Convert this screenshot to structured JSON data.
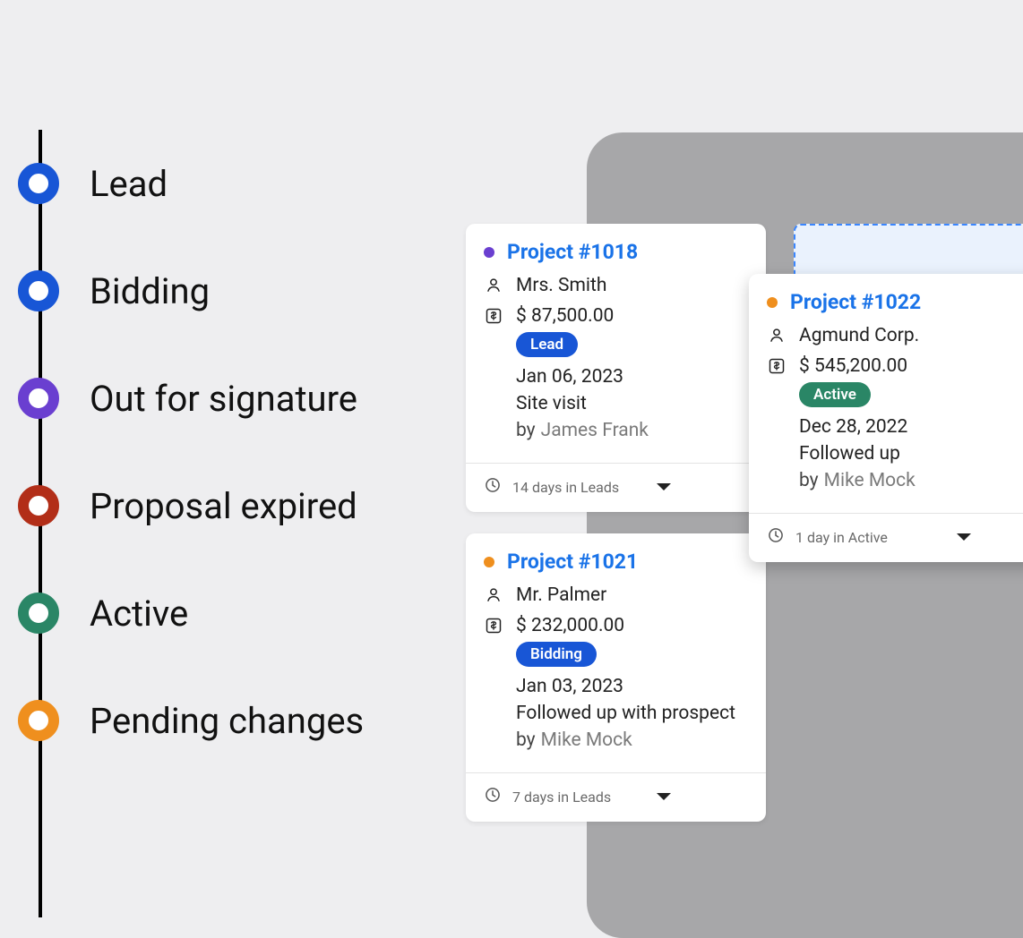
{
  "colors": {
    "blue": "#1856d6",
    "purple": "#6a3fd0",
    "redbrown": "#b22e18",
    "teal": "#2a8666",
    "orange": "#ef8f1e",
    "badge_blue": "#1856d6",
    "link": "#1a73e8"
  },
  "legend": [
    {
      "label": "Lead",
      "color": "#1856d6"
    },
    {
      "label": "Bidding",
      "color": "#1856d6"
    },
    {
      "label": "Out for signature",
      "color": "#6a3fd0"
    },
    {
      "label": "Proposal expired",
      "color": "#b22e18"
    },
    {
      "label": "Active",
      "color": "#2a8666"
    },
    {
      "label": "Pending changes",
      "color": "#ef8f1e"
    }
  ],
  "by_label": "by",
  "cards": {
    "c1018": {
      "dot_color": "#6a3fd0",
      "title": "Project #1018",
      "client": "Mrs. Smith",
      "amount": "$ 87,500.00",
      "status_label": "Lead",
      "status_bg": "#1856d6",
      "date": "Jan 06, 2023",
      "note": "Site visit",
      "by_person": "James Frank",
      "footer": "14 days in Leads"
    },
    "c1021": {
      "dot_color": "#ef8f1e",
      "title": "Project #1021",
      "client": "Mr. Palmer",
      "amount": "$ 232,000.00",
      "status_label": "Bidding",
      "status_bg": "#1856d6",
      "date": "Jan 03, 2023",
      "note": "Followed up with prospect",
      "by_person": "Mike Mock",
      "footer": "7 days in Leads"
    },
    "c1022": {
      "dot_color": "#ef8f1e",
      "title": "Project #1022",
      "client": "Agmund Corp.",
      "amount": "$ 545,200.00",
      "status_label": "Active",
      "status_bg": "#2a8666",
      "date": "Dec 28, 2022",
      "note": "Followed up",
      "by_person": "Mike Mock",
      "footer": "1 day in Active"
    }
  }
}
